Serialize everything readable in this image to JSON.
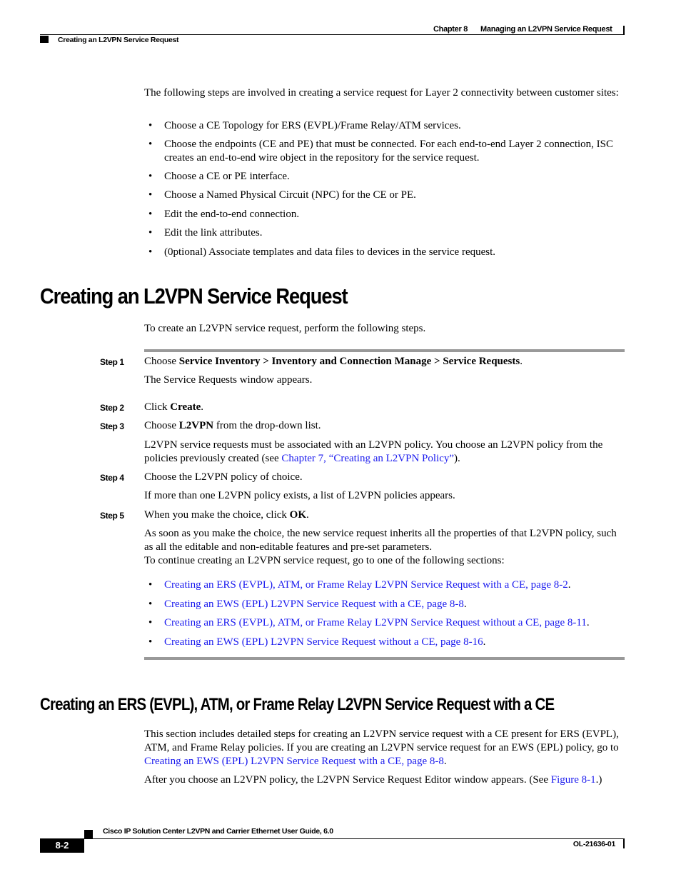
{
  "header": {
    "chapter_number": "Chapter 8",
    "chapter_title": "Managing an L2VPN Service Request",
    "section_title": "Creating an L2VPN Service Request"
  },
  "intro": {
    "paragraph": "The following steps are involved in creating a service request for Layer 2 connectivity between customer sites:",
    "bullets": [
      "Choose a CE Topology for ERS (EVPL)/Frame Relay/ATM services.",
      "Choose the endpoints (CE and PE) that must be connected. For each end-to-end Layer 2 connection, ISC creates an end-to-end wire object in the repository for the service request.",
      "Choose a CE or PE interface.",
      "Choose a Named Physical Circuit (NPC) for the CE or PE.",
      "Edit the end-to-end connection.",
      "Edit the link attributes.",
      "(0ptional) Associate templates and data files to devices in the service request."
    ]
  },
  "section1": {
    "heading": "Creating an L2VPN Service Request",
    "intro": "To create an L2VPN service request, perform the following steps.",
    "steps": [
      {
        "label": "Step 1",
        "text_prefix": "Choose ",
        "text_bold": "Service Inventory > Inventory and Connection Manage > Service Requests",
        "text_suffix": ".",
        "note": "The Service Requests window appears."
      },
      {
        "label": "Step 2",
        "text_prefix": "Click ",
        "text_bold": "Create",
        "text_suffix": "."
      },
      {
        "label": "Step 3",
        "text_prefix": "Choose ",
        "text_bold": "L2VPN",
        "text_suffix": " from the drop-down list.",
        "note_prefix": "L2VPN service requests must be associated with an L2VPN policy. You choose an L2VPN policy from the policies previously created (see ",
        "note_link": "Chapter 7, “Creating an L2VPN Policy”",
        "note_suffix": ")."
      },
      {
        "label": "Step 4",
        "text": "Choose the L2VPN policy of choice.",
        "note": "If more than one L2VPN policy exists, a list of L2VPN policies appears."
      },
      {
        "label": "Step 5",
        "text_prefix": "When you make the choice, click ",
        "text_bold": "OK",
        "text_suffix": ".",
        "note": "As soon as you make the choice, the new service request inherits all the properties of that L2VPN policy, such as all the editable and non-editable features and pre-set parameters.",
        "note2": "To continue creating an L2VPN service request, go to one of the following sections:",
        "links": [
          "Creating an ERS (EVPL), ATM, or Frame Relay L2VPN Service Request with a CE, page 8-2",
          "Creating an EWS (EPL) L2VPN Service Request with a CE, page 8-8",
          "Creating an ERS (EVPL), ATM, or Frame Relay L2VPN Service Request without a CE, page 8-11",
          "Creating an EWS (EPL) L2VPN Service Request without a CE, page 8-16"
        ]
      }
    ]
  },
  "section2": {
    "heading": "Creating an ERS (EVPL), ATM, or Frame Relay L2VPN Service Request with a CE",
    "para1_prefix": "This section includes detailed steps for creating an L2VPN service request with a CE present for ERS (EVPL), ATM, and Frame Relay policies. If you are creating an L2VPN service request for an EWS (EPL) policy, go to ",
    "para1_link": "Creating an EWS (EPL) L2VPN Service Request with a CE, page 8-8",
    "para1_suffix": ".",
    "para2_prefix": "After you choose an L2VPN policy, the L2VPN Service Request Editor window appears. (See ",
    "para2_link": "Figure 8-1",
    "para2_suffix": ".)"
  },
  "footer": {
    "guide_title": "Cisco IP Solution Center L2VPN and Carrier Ethernet User Guide, 6.0",
    "page_number": "8-2",
    "doc_number": "OL-21636-01"
  },
  "colors": {
    "link": "#1a1aee",
    "rule": "#999999"
  }
}
